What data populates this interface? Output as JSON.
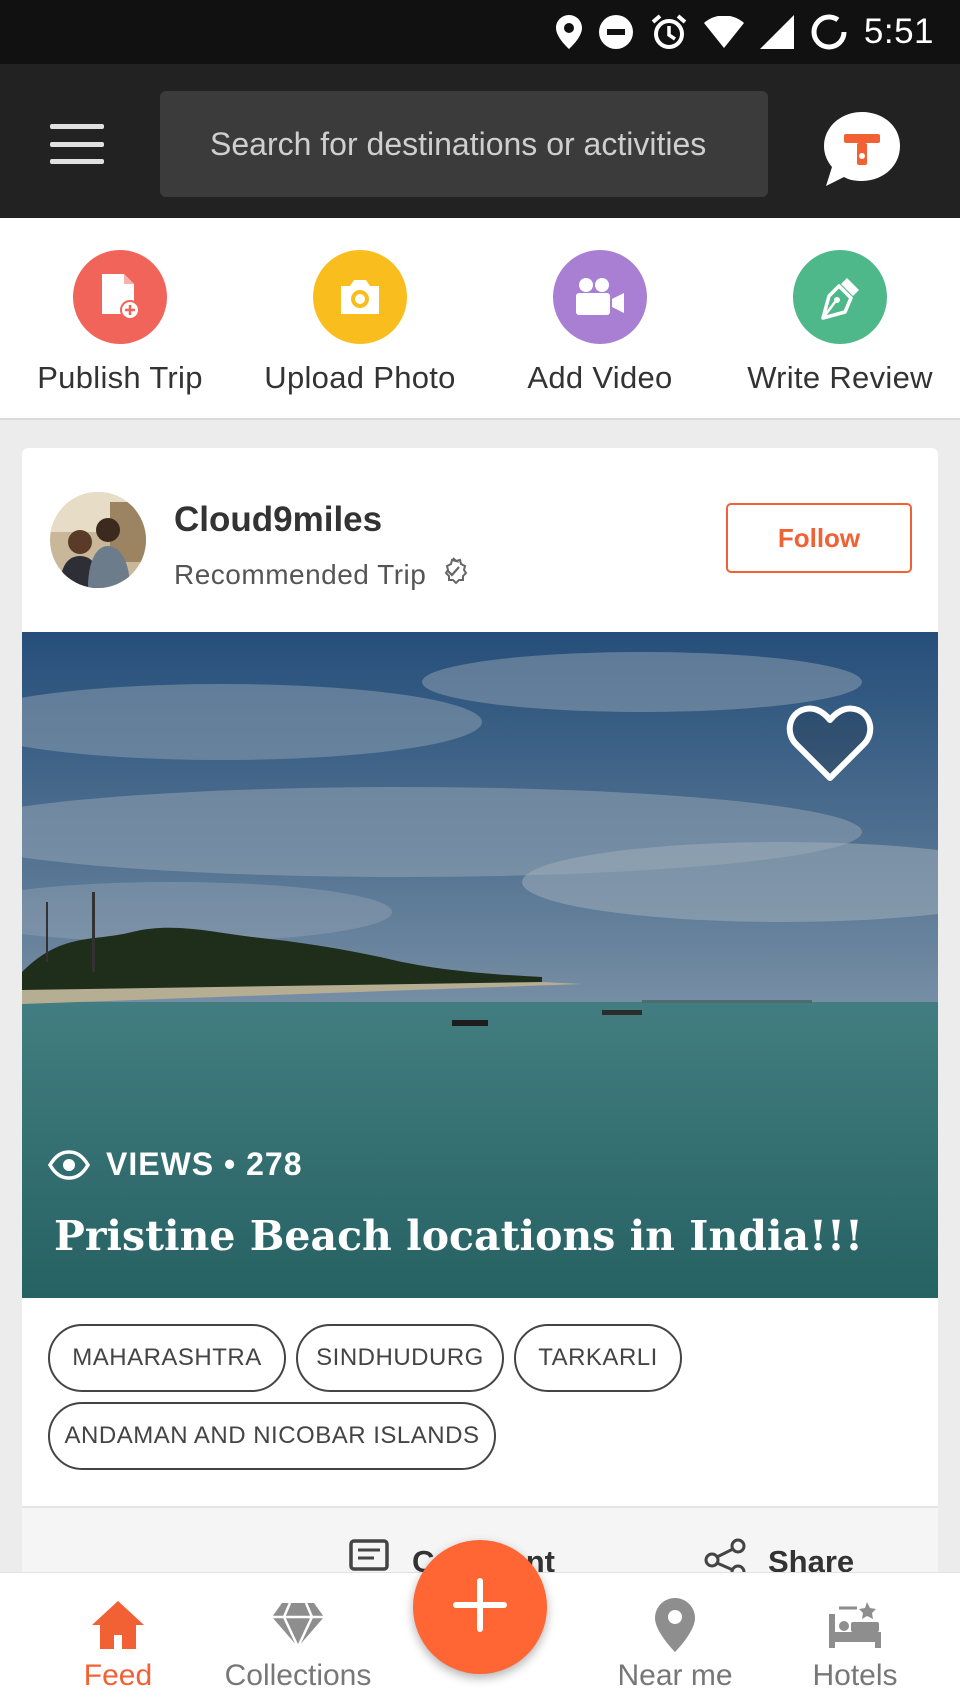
{
  "status_bar": {
    "time": "5:51",
    "icons": [
      "location-pin-icon",
      "do-not-disturb-icon",
      "alarm-clock-icon",
      "wifi-icon",
      "cell-signal-icon",
      "battery-icon"
    ]
  },
  "app_bar": {
    "menu_icon": "hamburger-menu-icon",
    "search_placeholder": "Search for destinations or activities",
    "logo_icon": "triptoto-chat-logo-icon"
  },
  "quick_actions": [
    {
      "label": "Publish Trip",
      "icon": "publish-trip-icon",
      "color": "#f0645a"
    },
    {
      "label": "Upload Photo",
      "icon": "camera-icon",
      "color": "#f9bd1e"
    },
    {
      "label": "Add Video",
      "icon": "video-camera-icon",
      "color": "#a97fd4"
    },
    {
      "label": "Write Review",
      "icon": "pen-nib-icon",
      "color": "#4fb88a"
    }
  ],
  "card": {
    "author": {
      "name": "Cloud9miles",
      "subtitle": "Recommended Trip",
      "verified_icon": "verified-check-icon"
    },
    "follow_label": "Follow",
    "views_label": "VIEWS • 278",
    "views_icon": "eye-icon",
    "title": "Pristine Beach locations in India!!!",
    "liked": false,
    "tags": [
      "MAHARASHTRA",
      "SINDHUDURG",
      "TARKARLI",
      "ANDAMAN AND NICOBAR ISLANDS"
    ],
    "actions": {
      "comment_label": "Comment",
      "share_label": "Share"
    }
  },
  "bottom_nav": {
    "items": [
      {
        "label": "Feed",
        "icon": "home-icon",
        "active": true
      },
      {
        "label": "Collections",
        "icon": "diamond-icon",
        "active": false
      },
      {
        "label": "Near me",
        "icon": "map-pin-icon",
        "active": false
      },
      {
        "label": "Hotels",
        "icon": "hotel-bed-icon",
        "active": false
      }
    ],
    "fab_icon": "plus-icon"
  },
  "colors": {
    "accent": "#f26134",
    "fab": "#ff6633",
    "app_bar": "#222222",
    "status_bar": "#111111"
  }
}
